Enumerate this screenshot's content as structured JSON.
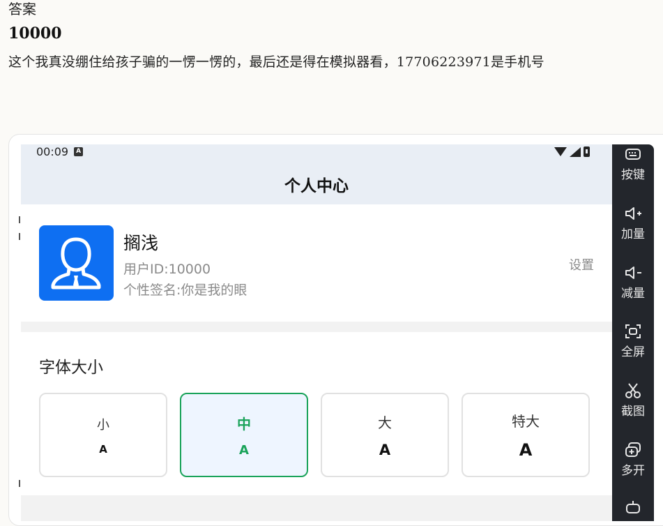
{
  "document": {
    "heading": "答案",
    "answer": "10000",
    "description": "这个我真没绷住给孩子骗的一愣一愣的，最后还是得在模拟器看，17706223971是手机号"
  },
  "status_bar": {
    "time": "00:09",
    "notification_icon": "a-badge-icon",
    "right_icons": [
      "wifi-icon",
      "signal-icon",
      "battery-icon"
    ]
  },
  "app": {
    "title": "个人中心",
    "profile": {
      "avatar_icon": "user-avatar-icon",
      "name": "搁浅",
      "user_id": "用户ID:10000",
      "signature": "个性签名:你是我的眼",
      "settings_label": "设置"
    },
    "font_size": {
      "title": "字体大小",
      "selected": "中",
      "options": [
        {
          "label": "小",
          "sample": "A"
        },
        {
          "label": "中",
          "sample": "A"
        },
        {
          "label": "大",
          "sample": "A"
        },
        {
          "label": "特大",
          "sample": "A"
        }
      ]
    }
  },
  "emulator_toolbar": {
    "items": [
      {
        "label": "按键",
        "icon": "keyboard-icon"
      },
      {
        "label": "加量",
        "icon": "volume-up-icon"
      },
      {
        "label": "减量",
        "icon": "volume-down-icon"
      },
      {
        "label": "全屏",
        "icon": "fullscreen-icon"
      },
      {
        "label": "截图",
        "icon": "scissors-icon"
      },
      {
        "label": "多开",
        "icon": "multi-window-icon"
      },
      {
        "label": "",
        "icon": "robot-icon"
      }
    ]
  },
  "colors": {
    "accent_green": "#1aa35a",
    "avatar_blue": "#0e6ff2",
    "header_bg": "#e9eef5",
    "toolbar_bg": "#23262c"
  }
}
